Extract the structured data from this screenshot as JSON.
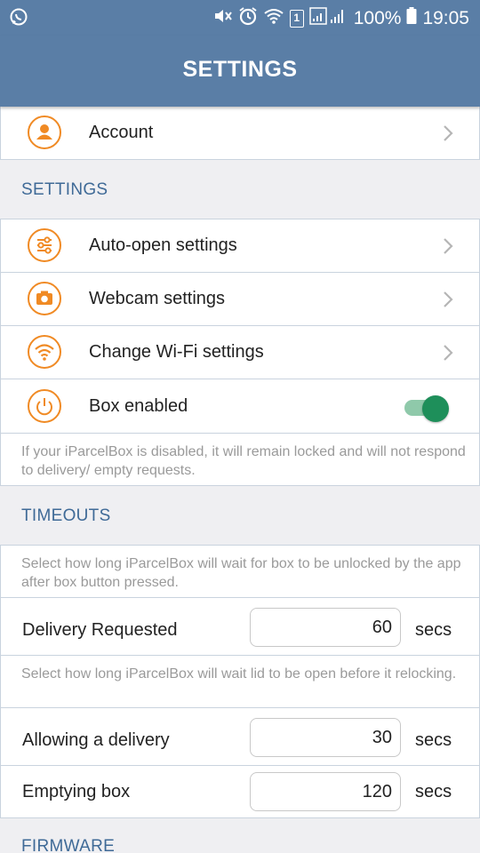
{
  "status_bar": {
    "battery": "100%",
    "time": "19:05",
    "sim_label": "1",
    "icons": [
      "whatsapp-icon",
      "mute-icon",
      "alarm-icon",
      "wifi-icon",
      "signal-icon",
      "battery-icon"
    ]
  },
  "app_bar": {
    "title": "SETTINGS"
  },
  "account": {
    "label": "Account",
    "icon": "person-icon"
  },
  "settings_section": {
    "header": "SETTINGS",
    "items": [
      {
        "label": "Auto-open settings",
        "icon": "sliders-icon"
      },
      {
        "label": "Webcam settings",
        "icon": "camera-icon"
      },
      {
        "label": "Change Wi-Fi settings",
        "icon": "wifi-icon"
      }
    ],
    "box_enabled": {
      "label": "Box enabled",
      "icon": "power-icon",
      "enabled": true
    },
    "box_enabled_hint": "If your iParcelBox is disabled, it will remain locked and will not respond to delivery/ empty requests."
  },
  "timeouts": {
    "header": "TIMEOUTS",
    "hint1": "Select how long iParcelBox will wait for box to be unlocked by the app after box button pressed.",
    "delivery_requested": {
      "label": "Delivery Requested",
      "value": "60",
      "unit": "secs"
    },
    "hint2": "Select how long iParcelBox will wait lid to be open before it relocking.",
    "allowing_delivery": {
      "label": "Allowing a delivery",
      "value": "30",
      "unit": "secs"
    },
    "emptying_box": {
      "label": "Emptying box",
      "value": "120",
      "unit": "secs"
    }
  },
  "firmware": {
    "header": "FIRMWARE"
  },
  "colors": {
    "primary": "#5a7ea6",
    "accent": "#f08a24",
    "toggle_on": "#1e8f5a",
    "section_text": "#3f6a97"
  }
}
